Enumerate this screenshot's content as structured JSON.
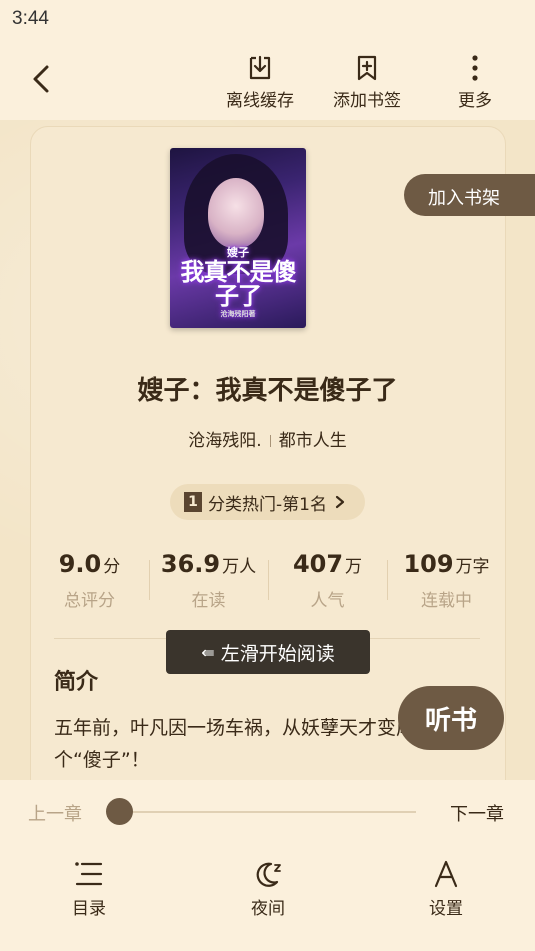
{
  "status": {
    "time": "3:44"
  },
  "top_bar": {
    "actions": [
      {
        "label": "离线缓存",
        "icon": "download-icon"
      },
      {
        "label": "添加书签",
        "icon": "bookmark-add-icon"
      },
      {
        "label": "更多",
        "icon": "more-vertical-icon"
      }
    ]
  },
  "book": {
    "cover": {
      "small_text": "嫂子",
      "big_text": "我真不是傻子了",
      "author_text": "沧海残阳著"
    },
    "add_shelf_label": "加入书架",
    "title": "嫂子：我真不是傻子了",
    "author": "沧海残阳.",
    "category": "都市人生",
    "rank": {
      "num": "1",
      "label": "分类热门-第1名"
    },
    "stats": [
      {
        "value": "9.0",
        "unit": "分",
        "caption": "总评分"
      },
      {
        "value": "36.9",
        "unit": "万人",
        "caption": "在读"
      },
      {
        "value": "407",
        "unit": "万",
        "caption": "人气"
      },
      {
        "value": "109",
        "unit": "万字",
        "caption": "连载中"
      }
    ],
    "intro_title": "简介",
    "intro_text": "五年前，叶凡因一场车祸，从妖孽天才变成一个“傻子”！"
  },
  "toast": {
    "text": "左滑开始阅读"
  },
  "listen_label": "听书",
  "bottom": {
    "prev_label": "上一章",
    "next_label": "下一章",
    "progress": 0,
    "nav": [
      {
        "label": "目录",
        "icon": "list-icon"
      },
      {
        "label": "夜间",
        "icon": "moon-icon"
      },
      {
        "label": "设置",
        "icon": "font-icon"
      }
    ]
  },
  "colors": {
    "accent": "#6e5a44",
    "background": "#f7ecd6",
    "text": "#3a2a18",
    "muted": "#b8a488"
  }
}
